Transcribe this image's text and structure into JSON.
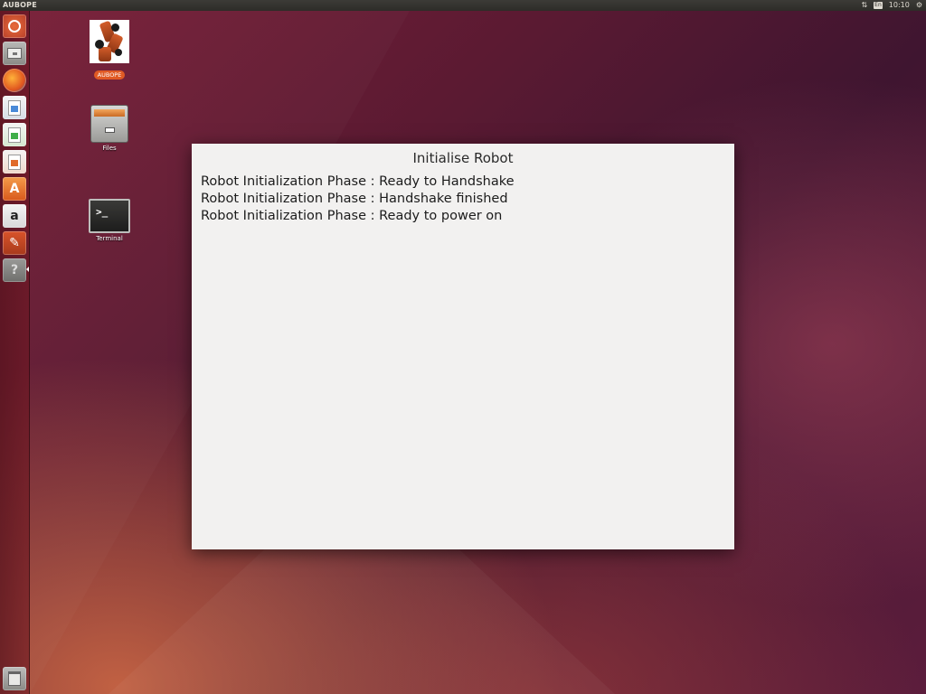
{
  "top_panel": {
    "app_title": "AUBOPE",
    "keyboard_indicator": "En",
    "clock": "10:10"
  },
  "launcher": {
    "items": [
      {
        "name": "dash-home",
        "icon": "ubuntu-logo-icon"
      },
      {
        "name": "files",
        "icon": "file-cabinet-icon"
      },
      {
        "name": "firefox",
        "icon": "firefox-icon"
      },
      {
        "name": "libreoffice-writer",
        "icon": "writer-icon"
      },
      {
        "name": "libreoffice-calc",
        "icon": "calc-icon"
      },
      {
        "name": "libreoffice-impress",
        "icon": "impress-icon"
      },
      {
        "name": "software-center",
        "icon": "software-center-icon"
      },
      {
        "name": "amazon",
        "icon": "amazon-icon"
      },
      {
        "name": "system-settings",
        "icon": "settings-icon"
      },
      {
        "name": "help",
        "icon": "help-icon"
      },
      {
        "name": "trash",
        "icon": "trash-icon"
      }
    ],
    "amazon_letter": "a",
    "software_letter": "A",
    "help_glyph": "?"
  },
  "desktop": {
    "icons": [
      {
        "label": "AUBOPE",
        "icon": "robot-arm-icon"
      },
      {
        "label": "Files",
        "icon": "file-cabinet-icon"
      },
      {
        "label": "Terminal",
        "icon": "terminal-icon"
      }
    ],
    "terminal_prompt": ">_"
  },
  "dialog": {
    "title": "Initialise Robot",
    "log_lines": [
      "Robot Initialization Phase : Ready to Handshake",
      "Robot Initialization Phase : Handshake finished",
      "Robot Initialization Phase : Ready to power on"
    ]
  },
  "colors": {
    "panel": "#2d2c28",
    "dialog_bg": "#f2f1f0",
    "accent_orange": "#e05a24",
    "wallpaper_dark": "#3f1530"
  }
}
